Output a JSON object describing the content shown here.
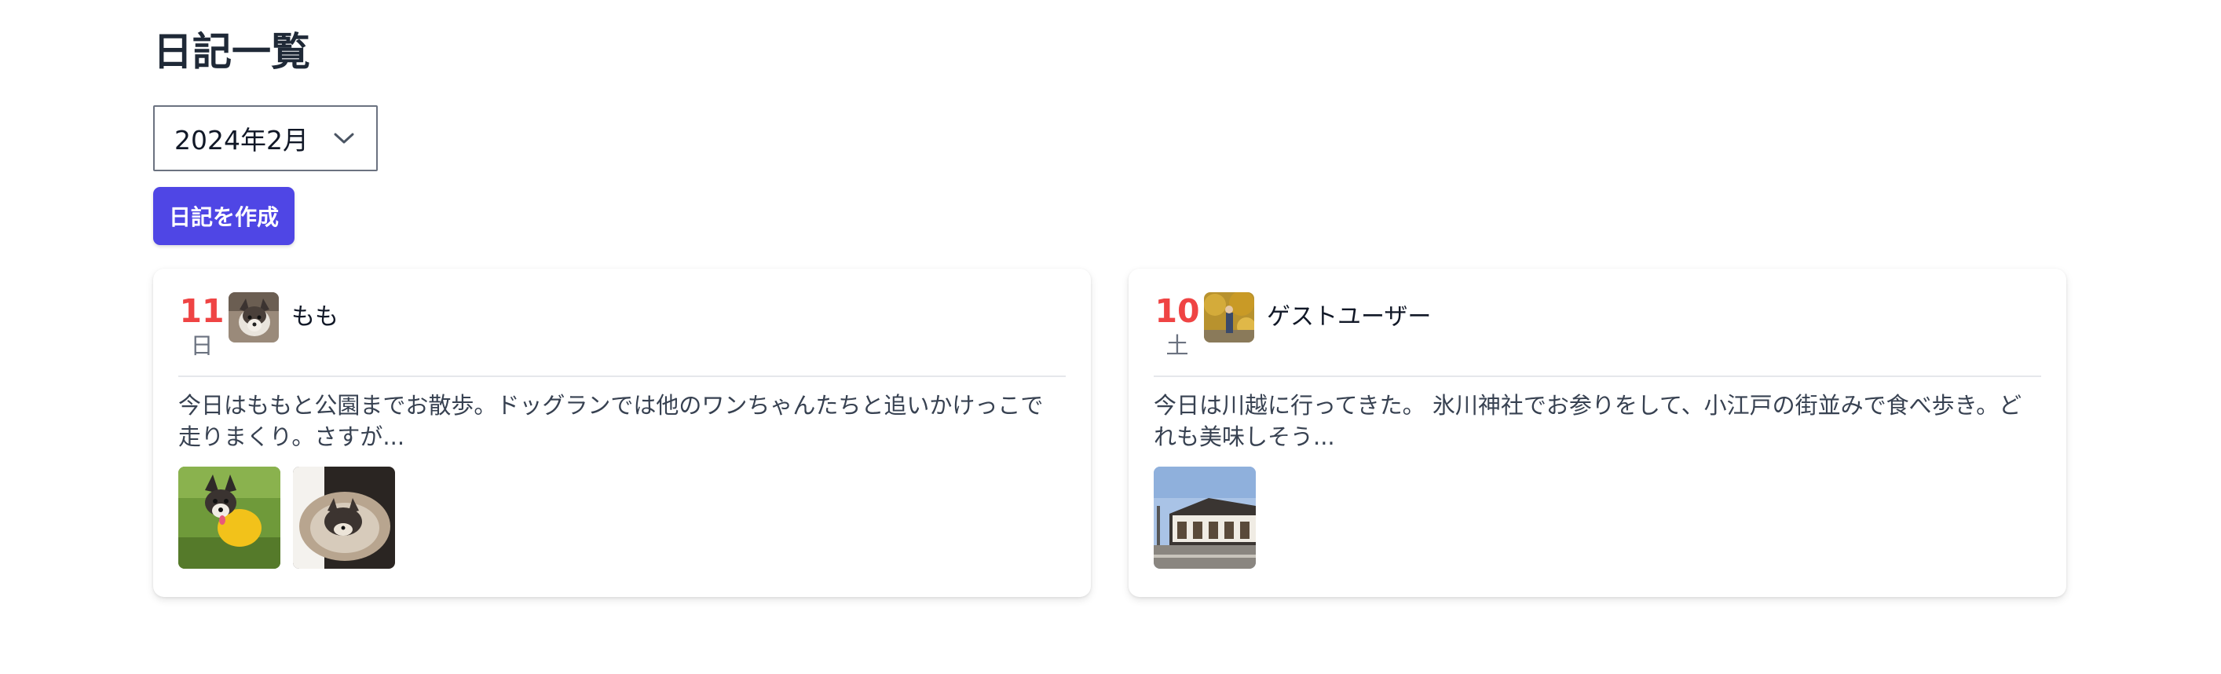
{
  "page": {
    "title": "日記一覧",
    "month_select_value": "2024年2月",
    "create_button_label": "日記を作成"
  },
  "colors": {
    "accent": "#4f46e5",
    "date": "#ef4444"
  },
  "entries": [
    {
      "day": "11",
      "weekday": "日",
      "user": "もも",
      "excerpt": "今日はももと公園までお散歩。ドッグランでは他のワンちゃんたちと追いかけっこで走りまくり。さすが...",
      "photo_count": 2
    },
    {
      "day": "10",
      "weekday": "土",
      "user": "ゲストユーザー",
      "excerpt": "今日は川越に行ってきた。 氷川神社でお参りをして、小江戸の街並みで食べ歩き。どれも美味しそう...",
      "photo_count": 1
    }
  ]
}
